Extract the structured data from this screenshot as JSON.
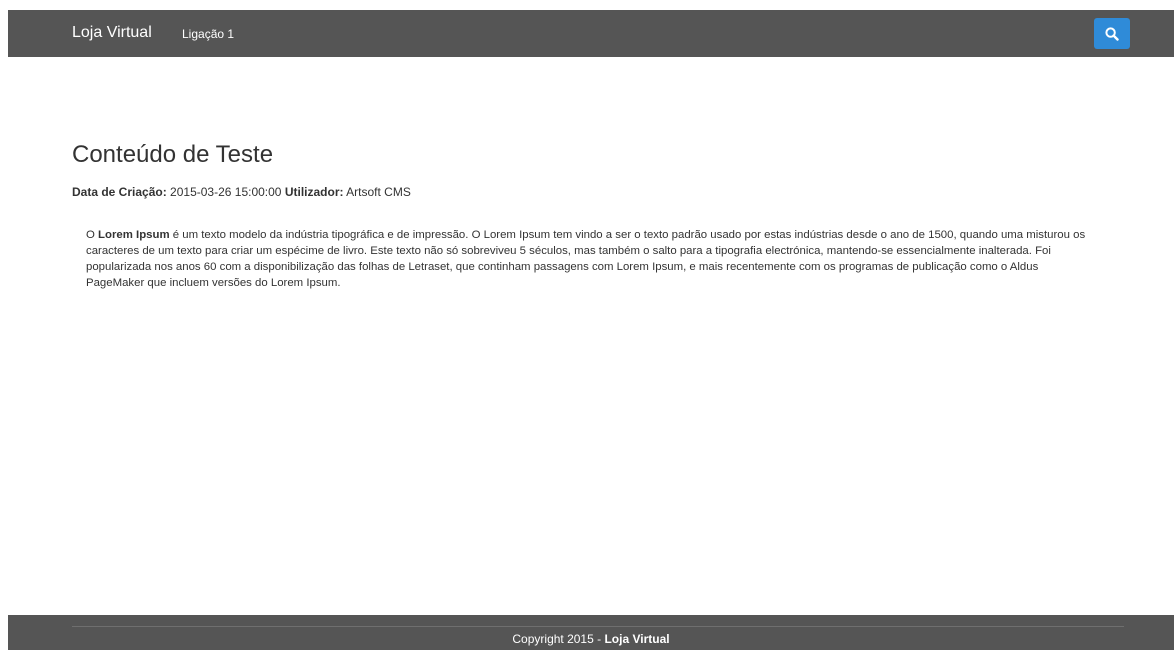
{
  "navbar": {
    "brand": "Loja Virtual",
    "links": [
      "Ligação 1"
    ],
    "search_icon": "search-icon"
  },
  "content": {
    "title": "Conteúdo de Teste",
    "meta": {
      "created_label": "Data de Criação:",
      "created_value": "2015-03-26 15:00:00",
      "user_label": "Utilizador:",
      "user_value": "Artsoft CMS"
    },
    "paragraph": {
      "prefix": "O",
      "strong": "Lorem Ipsum",
      "rest": "é um texto modelo da indústria tipográfica e de impressão. O Lorem Ipsum tem vindo a ser o texto padrão usado por estas indústrias desde o ano de 1500, quando uma misturou os caracteres de um texto para criar um espécime de livro. Este texto não só sobreviveu 5 séculos, mas também o salto para a tipografia electrónica, mantendo-se essencialmente inalterada. Foi popularizada nos anos 60 com a disponibilização das folhas de Letraset, que continham passagens com Lorem Ipsum, e mais recentemente com os programas de publicação como o Aldus PageMaker que incluem versões do Lorem Ipsum."
    }
  },
  "footer": {
    "copyright": "Copyright 2015 -",
    "brand": "Loja Virtual"
  },
  "colors": {
    "navbar_bg": "#555555",
    "accent": "#2f8bd8",
    "text": "#333333"
  }
}
